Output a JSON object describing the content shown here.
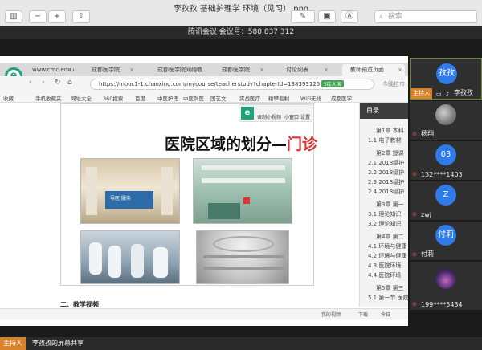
{
  "window": {
    "title": "李孜孜 基础护理学 环境（见习）.png",
    "search_placeholder": "搜索"
  },
  "meeting": {
    "header": "腾讯会议 会议号：588 837 312",
    "bottom_host_tag": "主持人",
    "bottom_share_text": "李孜孜的屏幕共享"
  },
  "browser": {
    "tabs": [
      "www.cmc.edu.cn",
      "成都医学院",
      "成都医学院网络教",
      "成都医学院",
      "讨论列表",
      "教师预览页面"
    ],
    "url": "https://mooc1-1.chaoxing.com/mycourse/teacherstudy?chapterId=138393125",
    "url_badge": "5库大国",
    "search_hint": "今晚拉市",
    "bookmarks": [
      "收藏",
      "手机收藏夹",
      "网址大全",
      "360搜索",
      "百度",
      "中医护理",
      "中医刺医",
      "国艺文",
      "实战医疗",
      "精攀看剩",
      "WiFi无线",
      "成都医学"
    ]
  },
  "doc": {
    "title_main": "医院区域的划分—",
    "title_accent": "门诊",
    "mini_toolbar": [
      "录制小视频",
      "小窗口",
      "设置"
    ],
    "section_title": "二、教学视频",
    "photo_sign": "导医 服务"
  },
  "toc": {
    "header": "目录",
    "items": [
      "第1章 本科",
      "1.1 电子教材",
      "第2章 授课",
      "2.1 2018级护",
      "2.2 2018级护",
      "2.3 2018级护",
      "2.4 2018级护",
      "第3章 第一",
      "3.1 理论知识",
      "3.2 理论知识",
      "第4章 第二",
      "4.1 环境与健康",
      "4.2 环境与健康",
      "4.3 医院环境",
      "4.4 医院环境",
      "第5章 第三",
      "5.1 第一节 医院"
    ]
  },
  "status": {
    "items": [
      "我的视频",
      "下载",
      "今日"
    ]
  },
  "participants": [
    {
      "name": "李孜孜",
      "avatar_text": "孜孜",
      "host": "主持人",
      "type": "avatar",
      "color": "#2f7bea"
    },
    {
      "name": "杨翔",
      "avatar_text": "",
      "type": "photo"
    },
    {
      "name": "132****1403",
      "avatar_text": "03",
      "type": "avatar",
      "color": "#2f7bea"
    },
    {
      "name": "zwj",
      "avatar_text": "Z",
      "type": "avatar",
      "color": "#2f7bea"
    },
    {
      "name": "付莉",
      "avatar_text": "付莉",
      "type": "avatar",
      "color": "#2f7bea"
    },
    {
      "name": "199****5434",
      "avatar_text": "",
      "type": "photo"
    }
  ],
  "icons": [
    "sidebar-toggle-icon",
    "zoom-out-icon",
    "zoom-in-icon",
    "share-icon",
    "pen-icon",
    "toolbox-icon",
    "annotate-icon",
    "search-icon",
    "mic-muted-icon",
    "screen-share-icon"
  ]
}
